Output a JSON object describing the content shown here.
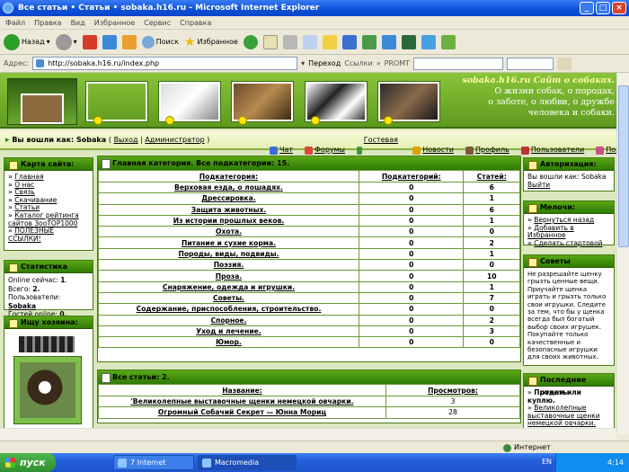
{
  "window": {
    "title": "Все статьи • Статьи • sobaka.h16.ru - Microsoft Internet Explorer"
  },
  "menu": [
    "Файл",
    "Правка",
    "Вид",
    "Избранное",
    "Сервис",
    "Справка"
  ],
  "toolbar": {
    "back": "Назад",
    "search": "Поиск",
    "favorites": "Избранное"
  },
  "addressbar": {
    "label": "Адрес:",
    "url": "http://sobaka.h16.ru/index.php",
    "go": "Переход",
    "links": "Ссылки",
    "promt": "PROMT"
  },
  "banner": {
    "title": "sobaka.h16.ru Сайт о собаках.",
    "line1": "О жизни собак, о породах,",
    "line2": "о заботе, о любви, о дружбе",
    "line3": "человека и собаки."
  },
  "navbar": {
    "logged_prefix": "Вы вошли как: Sobaka",
    "exit": "Выход",
    "admin": "Администратор",
    "links": [
      {
        "label": "Чат",
        "icon": "chat-icon",
        "color": "#3a6bd6"
      },
      {
        "label": "Форумы",
        "icon": "forum-icon",
        "color": "#d64a3a"
      },
      {
        "label": "Гостевая книга",
        "icon": "book-icon",
        "color": "#3a9a3a"
      },
      {
        "label": "Новости",
        "icon": "news-icon",
        "color": "#e0a000"
      },
      {
        "label": "Профиль",
        "icon": "profile-icon",
        "color": "#7a5a3a"
      },
      {
        "label": "Пользователи",
        "icon": "users-icon",
        "color": "#c03030"
      },
      {
        "label": "Помощь",
        "icon": "help-icon",
        "color": "#c84f8a"
      }
    ]
  },
  "sitemap": {
    "title": "Карта сайта:",
    "items": [
      "Главная",
      "О нас",
      "Связь",
      "Скачивание",
      "Статьи",
      "Каталог рейтинга сайтов ЗооТОР1000",
      "ПОЛЕЗНЫЕ ССЫЛКИ!"
    ]
  },
  "stats": {
    "title": "Статистика",
    "online_label": "Online сейчас:",
    "online_val": "1",
    "total_label": "Всего:",
    "total_val": "2.",
    "users_label": "Пользователи:",
    "user": "Sobaka",
    "guests_label": "Гостей online:",
    "guests_val": "0."
  },
  "owner": {
    "title": "Ищу хозяина:"
  },
  "main": {
    "header": "Главная категория. Все подкатегории: 15.",
    "col_sub": "Подкатегория:",
    "col_subsub": "Подкатегорий:",
    "col_art": "Статей:",
    "rows": [
      {
        "name": "Верховая езда, о лошадях.",
        "sub": "0",
        "art": "6"
      },
      {
        "name": "Дрессировка.",
        "sub": "0",
        "art": "1"
      },
      {
        "name": "Защита животных.",
        "sub": "0",
        "art": "6"
      },
      {
        "name": "Из истории прошлых веков.",
        "sub": "0",
        "art": "1"
      },
      {
        "name": "Охота.",
        "sub": "0",
        "art": "0"
      },
      {
        "name": "Питание и сухие корма.",
        "sub": "0",
        "art": "2"
      },
      {
        "name": "Породы, виды, подвиды.",
        "sub": "0",
        "art": "1"
      },
      {
        "name": "Поэзия.",
        "sub": "0",
        "art": "0"
      },
      {
        "name": "Проза.",
        "sub": "0",
        "art": "10"
      },
      {
        "name": "Снаряжение, одежда и игрушки.",
        "sub": "0",
        "art": "1"
      },
      {
        "name": "Советы.",
        "sub": "0",
        "art": "7"
      },
      {
        "name": "Содержание, приспособления, строительство.",
        "sub": "0",
        "art": "0"
      },
      {
        "name": "Спорное.",
        "sub": "0",
        "art": "2"
      },
      {
        "name": "Уход и лечение.",
        "sub": "0",
        "art": "3"
      },
      {
        "name": "Юмор.",
        "sub": "0",
        "art": "0"
      }
    ],
    "articles_header": "Все статьи: 2.",
    "col_title": "Название:",
    "col_views": "Просмотров:",
    "articles": [
      {
        "name": "'Великолепные выставочные щенки немецкой овчарки.",
        "views": "3"
      },
      {
        "name": "Огромный Собачий Секрет — Юнна Мориц",
        "views": "28"
      }
    ]
  },
  "auth": {
    "title": "Авторизация:",
    "text": "Вы вошли как: Sobaka",
    "exit": "Выйти"
  },
  "misc": {
    "title": "Мелочи:",
    "items": [
      "Вернуться назад",
      "Добавить в Избранное",
      "Сделать стартовой"
    ]
  },
  "tips": {
    "title": "Советы",
    "text": "Не разрешайте щенку грызть ценные вещи. Приучайте щенка играть и грызть только свои игрушки. Следите за тем, что бы у щенка всегда был богатый выбор своих игрушек. Покупайте только качественные и безопасные игрушки для своих животных."
  },
  "last": {
    "title": "Последние ответы",
    "sell": "Продам или куплю.",
    "link": "Великолепные выставочные щенки немецкой овчарки."
  },
  "status": {
    "zone": "Интернет"
  },
  "taskbar": {
    "start": "пуск",
    "tasks": [
      "7 Internet Explorer",
      "Macromedia Dreamw..."
    ],
    "lang": "EN",
    "time": "4:14"
  }
}
